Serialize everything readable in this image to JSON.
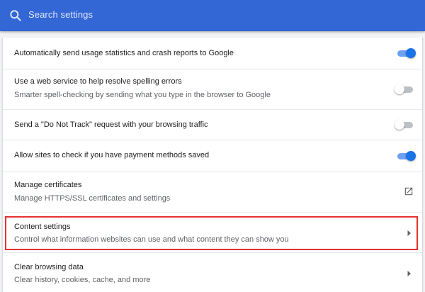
{
  "search": {
    "placeholder": "Search settings",
    "icon": "search-icon"
  },
  "colors": {
    "header": "#3367d6",
    "accent": "#1a73e8",
    "highlight": "#e5312f"
  },
  "settings": {
    "usage_stats": {
      "label": "Automatically send usage statistics and crash reports to Google",
      "enabled": true
    },
    "spelling": {
      "label": "Use a web service to help resolve spelling errors",
      "sublabel": "Smarter spell-checking by sending what you type in the browser to Google",
      "enabled": false
    },
    "do_not_track": {
      "label": "Send a \"Do Not Track\" request with your browsing traffic",
      "enabled": false
    },
    "payment_methods": {
      "label": "Allow sites to check if you have payment methods saved",
      "enabled": true
    },
    "certificates": {
      "label": "Manage certificates",
      "sublabel": "Manage HTTPS/SSL certificates and settings",
      "icon": "launch-icon"
    },
    "content_settings": {
      "label": "Content settings",
      "sublabel": "Control what information websites can use and what content they can show you",
      "icon": "chevron-right-icon",
      "highlighted": true
    },
    "clear_data": {
      "label": "Clear browsing data",
      "sublabel": "Clear history, cookies, cache, and more",
      "icon": "chevron-right-icon"
    }
  }
}
